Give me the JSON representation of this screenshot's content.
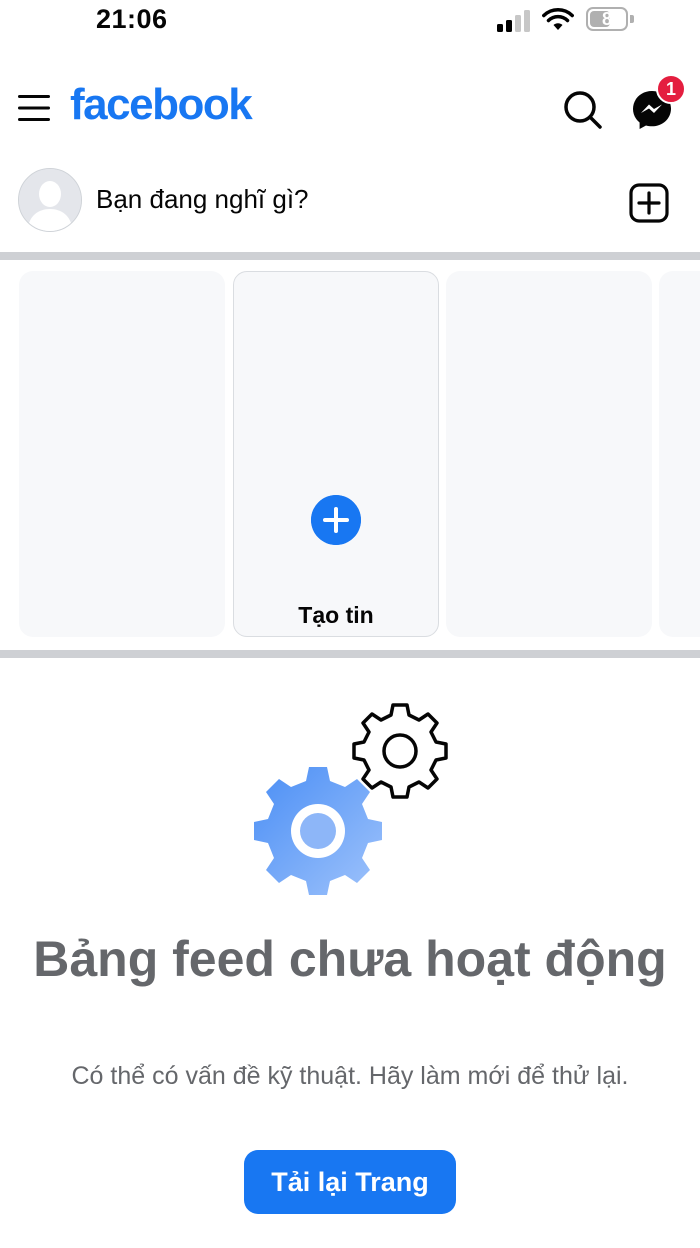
{
  "status_bar": {
    "time": "21:06",
    "battery": "8"
  },
  "header": {
    "logo": "facebook",
    "messenger_badge": "1"
  },
  "composer": {
    "placeholder": "Bạn đang nghĩ gì?"
  },
  "stories": {
    "create_label": "Tạo tin"
  },
  "empty_state": {
    "title": "Bảng feed chưa hoạt động",
    "description": "Có thể có vấn đề kỹ thuật. Hãy làm mới để thử lại.",
    "reload_label": "Tải lại Trang"
  },
  "colors": {
    "brand": "#1877f2",
    "badge": "#e41e3f",
    "muted_text": "#65676b",
    "divider": "#ced0d4"
  },
  "icons": [
    "menu-icon",
    "search-icon",
    "messenger-icon",
    "add-post-icon",
    "plus-icon",
    "gear-icon"
  ]
}
